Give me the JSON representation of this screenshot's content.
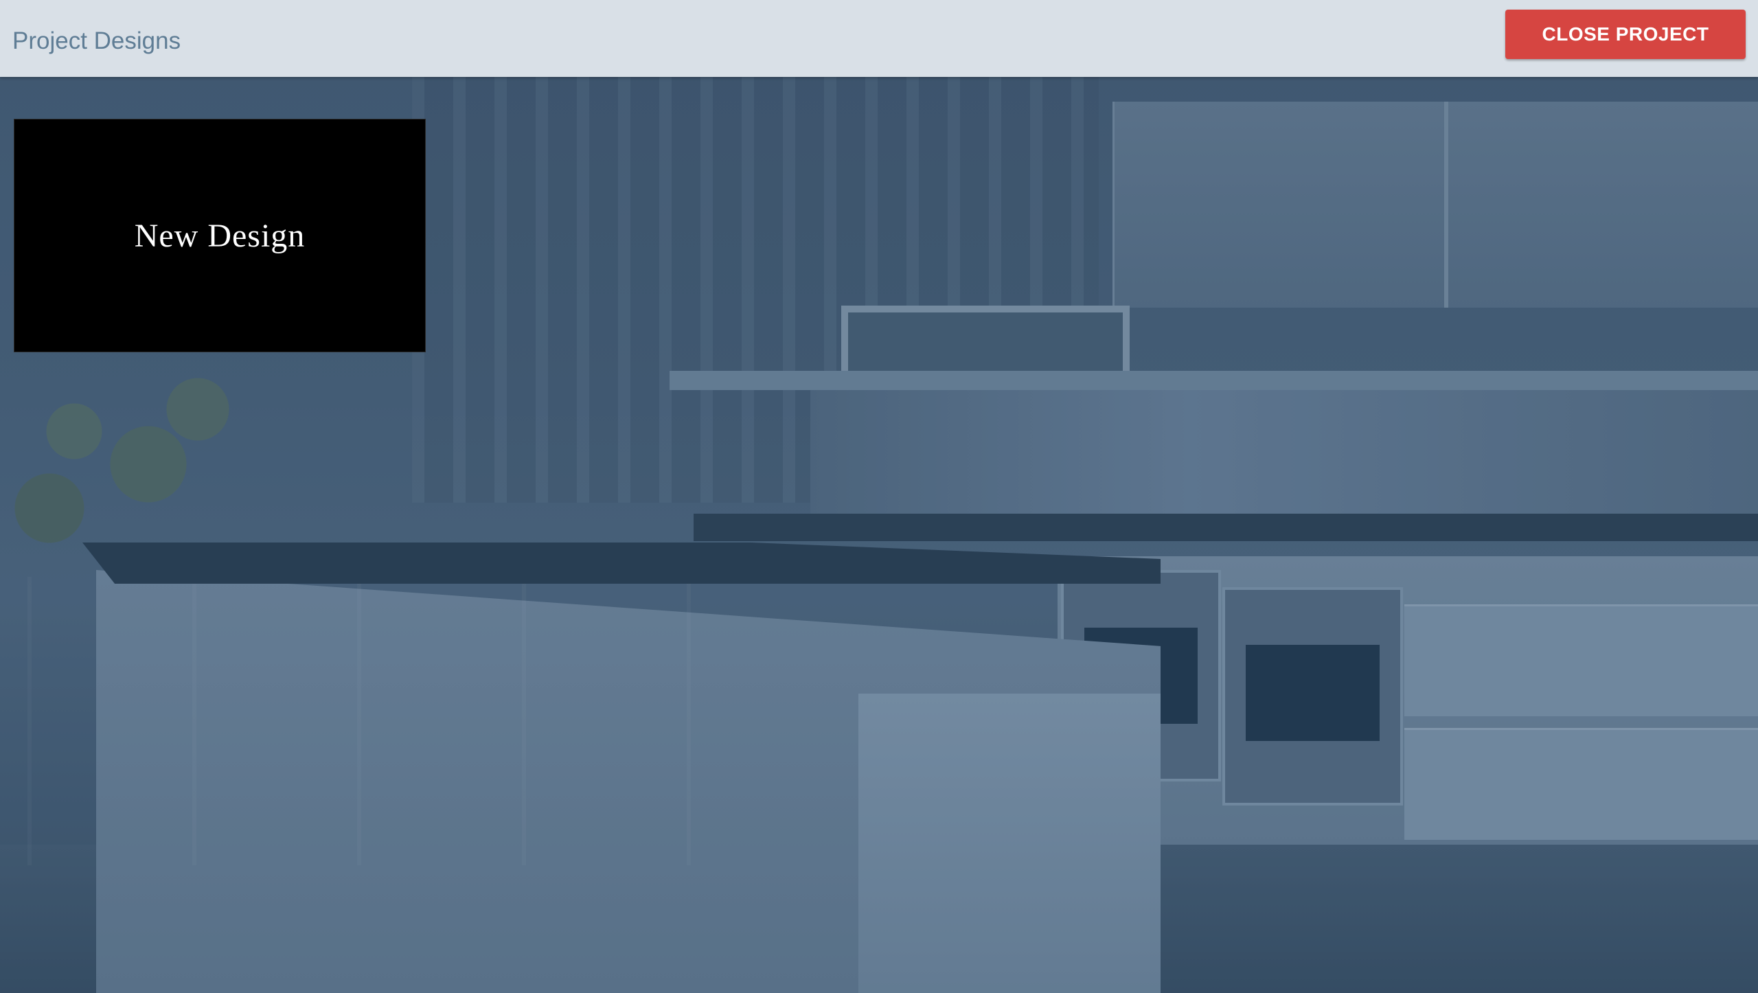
{
  "header": {
    "title": "Project Designs",
    "close_button_label": "CLOSE PROJECT"
  },
  "designs": [
    {
      "label": "New Design"
    }
  ],
  "colors": {
    "header_background": "#e2e8ed",
    "header_title": "#5f7d95",
    "close_button": "#d64541",
    "design_card": "#000000"
  }
}
